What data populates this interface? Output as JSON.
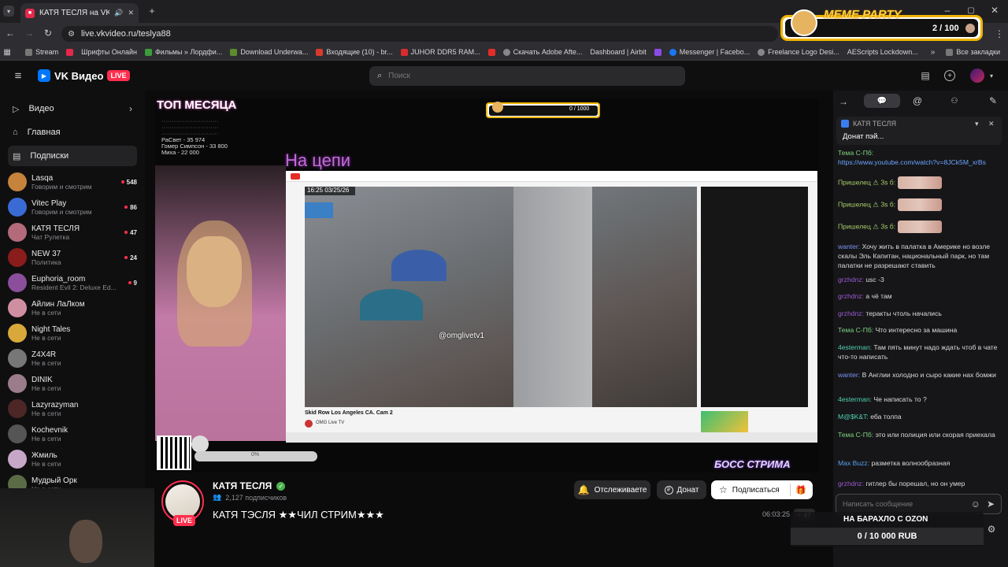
{
  "browser": {
    "tab_title": "КАТЯ ТЕСЛЯ на VK Видео",
    "url": "live.vkvideo.ru/teslya88",
    "bookmarks": [
      "Stream",
      "Шрифты Онлайн",
      "Фильмы » Лордфи...",
      "Download Underwa...",
      "Входящие (10) - br...",
      "JUHOR DDR5 RAM...",
      "Скачать Adobe Afte...",
      "Dashboard | Airbit",
      "Messenger | Facebo...",
      "Freelance Logo Desi...",
      "AEScripts Lockdown..."
    ],
    "all_bookmarks": "Все закладки"
  },
  "meme_party": {
    "label": "MEME PARTY",
    "count": "2 / 100"
  },
  "vk": {
    "brand": "VK Видео",
    "live": "LIVE",
    "search_placeholder": "Поиск"
  },
  "sidebar": {
    "nav": [
      {
        "label": "Видео"
      },
      {
        "label": "Главная"
      },
      {
        "label": "Подписки"
      }
    ],
    "channels": [
      {
        "name": "Lasqa",
        "sub": "Говорим и смотрим",
        "count": "548",
        "color": "#c5833b"
      },
      {
        "name": "Vitec Play",
        "sub": "Говорим и смотрим",
        "count": "86",
        "color": "#3a6ad4"
      },
      {
        "name": "КАТЯ ТЕСЛЯ",
        "sub": "Чат Рулетка",
        "count": "47",
        "color": "#b36a7a"
      },
      {
        "name": "NEW 37",
        "sub": "Политика",
        "count": "24",
        "color": "#8a1c1c"
      },
      {
        "name": "Euphoria_room",
        "sub": "Resident Evil 2: Deluxe Ed...",
        "count": "9",
        "color": "#8a4e9a"
      },
      {
        "name": "Айлин ЛаЛком",
        "sub": "Не в сети",
        "count": "",
        "color": "#d08fa0"
      },
      {
        "name": "Night Tales",
        "sub": "Не в сети",
        "count": "",
        "color": "#d8a93a"
      },
      {
        "name": "Z4X4R",
        "sub": "Не в сети",
        "count": "",
        "color": "#777"
      },
      {
        "name": "DINIK",
        "sub": "Не в сети",
        "count": "",
        "color": "#9b7c8a"
      },
      {
        "name": "Lazyrazyman",
        "sub": "Не в сети",
        "count": "",
        "color": "#4d2626"
      },
      {
        "name": "Kochevnik",
        "sub": "Не в сети",
        "count": "",
        "color": "#555"
      },
      {
        "name": "Жмиль",
        "sub": "Не в сети",
        "count": "",
        "color": "#c7a7c7"
      },
      {
        "name": "Мудрый Орк",
        "sub": "Не в сети",
        "count": "",
        "color": "#5b6b45"
      }
    ]
  },
  "stream": {
    "overlay_top": "ТОП МЕСЯЦА",
    "overlay_list": [
      "РаСвет - 35 974",
      "Гомер Симпсон - 33 800",
      "Миха - 22 000"
    ],
    "overlay_title": "На цепи",
    "meme_count": "0 / 1000",
    "inner_time": "16:25 03/25/26",
    "inner_watermark": "@omglivetv1",
    "inner_caption": "Skid Row Los Angeles CA. Cam 2",
    "inner_channel": "OMG Live TV",
    "boss": "БОСС СТРИМА",
    "goal_pct": "0%"
  },
  "channel": {
    "name": "КАТЯ ТЕСЛЯ",
    "subscribers": "2,127 подписчиков",
    "title": "КАТЯ ТЭСЛЯ ★★ЧИЛ СТРИМ★★★",
    "follow_btn": "Отслеживаете",
    "donate_btn": "Донат",
    "subscribe_btn": "Подписаться",
    "live": "LIVE",
    "duration": "06:03:25",
    "viewers": "47"
  },
  "chat": {
    "pinned_name": "КАТЯ ТЕСЛЯ",
    "pinned_text": "Донат пэй...",
    "messages": [
      {
        "user": "Тема С-Пб:",
        "text": "",
        "link": "https://www.youtube.com/watch?v=8JCk5M_xrBs",
        "ucolor": "#7fd27f"
      },
      {
        "user": "Пришелец ⚠ 3s б:",
        "text": "",
        "ucolor": "#a9cf6a"
      },
      {
        "user": "Пришелец ⚠ 3s б:",
        "text": "",
        "ucolor": "#a9cf6a"
      },
      {
        "user": "Пришелец ⚠ 3s б:",
        "text": "",
        "ucolor": "#a9cf6a"
      },
      {
        "user": "wanter:",
        "text": "Хочу жить в палатка в Америке но возле скалы Эль Капитан, национальный парк, но там палатки не разрешают ставить",
        "ucolor": "#7a95f0"
      },
      {
        "user": "grzhdnz:",
        "text": "usc -3",
        "ucolor": "#9b59d0"
      },
      {
        "user": "grzhdnz:",
        "text": "а чё там",
        "ucolor": "#9b59d0"
      },
      {
        "user": "grzhdnz:",
        "text": "теракты чтоль начались",
        "ucolor": "#9b59d0"
      },
      {
        "user": "Тема С-Пб:",
        "text": "Что интересно за машина",
        "ucolor": "#7fd27f"
      },
      {
        "user": "4esterman:",
        "text": "Там пять минут надо ждать чтоб в чате что-то написать",
        "ucolor": "#4fd0b0"
      },
      {
        "user": "wanter:",
        "text": "В Англии холодно и сыро какие нах бомжи",
        "ucolor": "#7a95f0"
      },
      {
        "user": "4esterman:",
        "text": "Че написать то ?",
        "ucolor": "#4fd0b0"
      },
      {
        "user": "M@$K&T:",
        "text": "еба толпа",
        "ucolor": "#4fd0b0"
      },
      {
        "user": "Тема С-Пб:",
        "text": "это или полиция или скорая приехала",
        "ucolor": "#7fd27f"
      },
      {
        "user": "Max Buzz:",
        "text": "разметка волнообразная",
        "ucolor": "#5aa0f0"
      },
      {
        "user": "grzhdnz:",
        "text": "гитлер бы порешал, но он умер",
        "ucolor": "#9b59d0"
      }
    ],
    "input_placeholder": "Написать сообщение",
    "goal_title": "НА БАРАХЛО С OZON",
    "goal_value": "0 / 10 000 RUB"
  }
}
